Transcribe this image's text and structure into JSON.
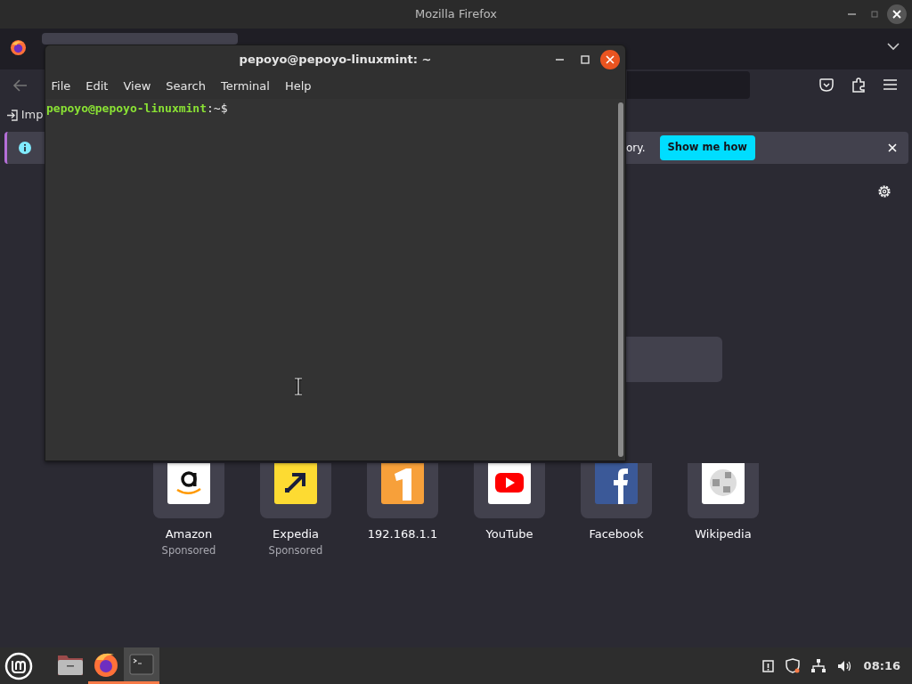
{
  "firefox": {
    "title": "Mozilla Firefox",
    "bookmark": "Imp",
    "notification": {
      "text": "ory.",
      "button": "Show me how"
    },
    "shortcuts": [
      {
        "kind": "amazon",
        "label": "Amazon",
        "note": "Sponsored"
      },
      {
        "kind": "expedia",
        "label": "Expedia",
        "note": "Sponsored"
      },
      {
        "kind": "router",
        "label": "192.168.1.1"
      },
      {
        "kind": "youtube",
        "label": "YouTube"
      },
      {
        "kind": "facebook",
        "label": "Facebook"
      },
      {
        "kind": "wikipedia",
        "label": "Wikipedia"
      }
    ]
  },
  "terminal": {
    "title": "pepoyo@pepoyo-linuxmint: ~",
    "menu": [
      "File",
      "Edit",
      "View",
      "Search",
      "Terminal",
      "Help"
    ],
    "prompt": {
      "user_host": "pepoyo@pepoyo-linuxmint",
      "path": ":~$"
    }
  },
  "taskbar": {
    "apps": [
      {
        "kind": "files",
        "running": false,
        "focused": false
      },
      {
        "kind": "firefox",
        "running": true,
        "focused": false
      },
      {
        "kind": "terminal",
        "running": true,
        "focused": true
      }
    ],
    "clock": "08:16"
  }
}
